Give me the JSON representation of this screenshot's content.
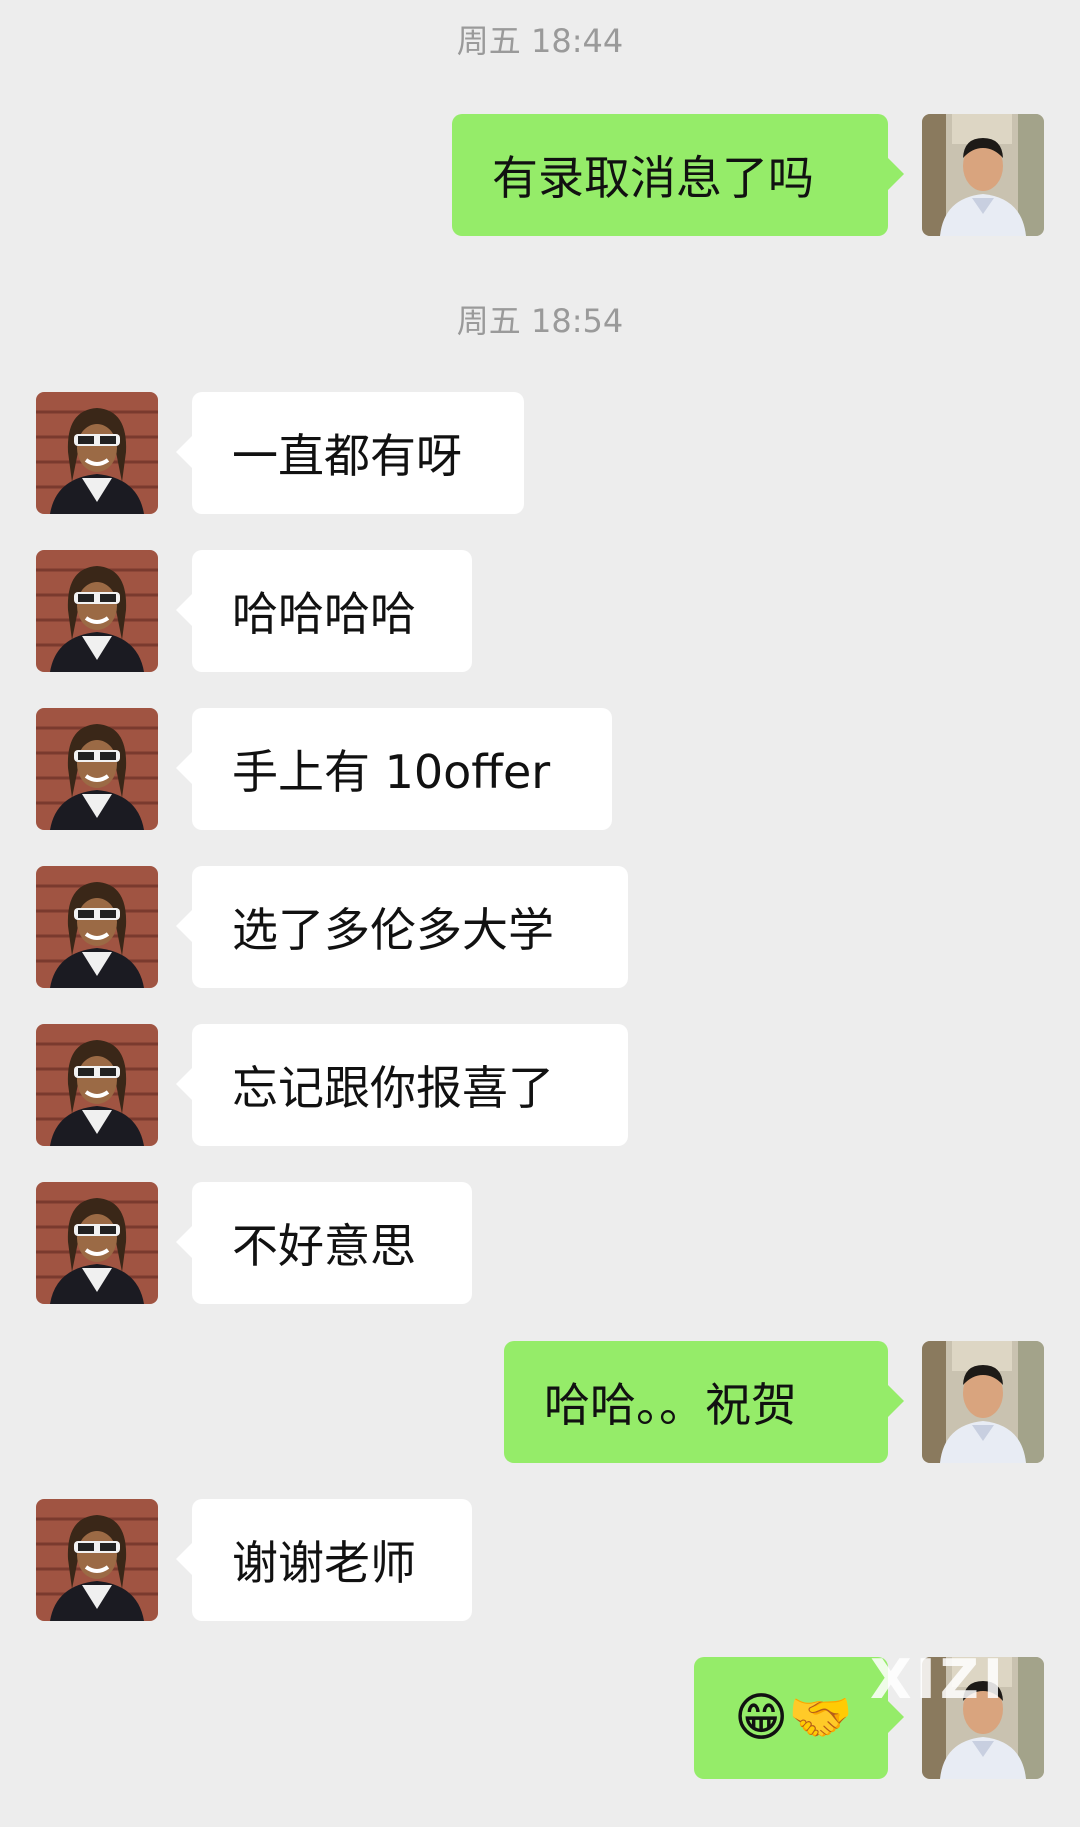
{
  "chat": {
    "timestamps": [
      "周五 18:44",
      "周五 18:54"
    ],
    "messages": [
      {
        "side": "out",
        "text": "有录取消息了吗"
      },
      {
        "side": "in",
        "text": "一直都有呀"
      },
      {
        "side": "in",
        "text": "哈哈哈哈"
      },
      {
        "side": "in",
        "text": "手上有 10offer"
      },
      {
        "side": "in",
        "text": "选了多伦多大学"
      },
      {
        "side": "in",
        "text": "忘记跟你报喜了"
      },
      {
        "side": "in",
        "text": "不好意思"
      },
      {
        "side": "out",
        "text": "哈哈。。祝贺"
      },
      {
        "side": "in",
        "text": "谢谢老师"
      },
      {
        "side": "out",
        "text": "😁🤝"
      }
    ]
  },
  "watermark": "XIZI",
  "colors": {
    "background": "#ededed",
    "outgoing_bubble": "#95ec69",
    "incoming_bubble": "#ffffff",
    "timestamp": "#9a9a9a"
  }
}
